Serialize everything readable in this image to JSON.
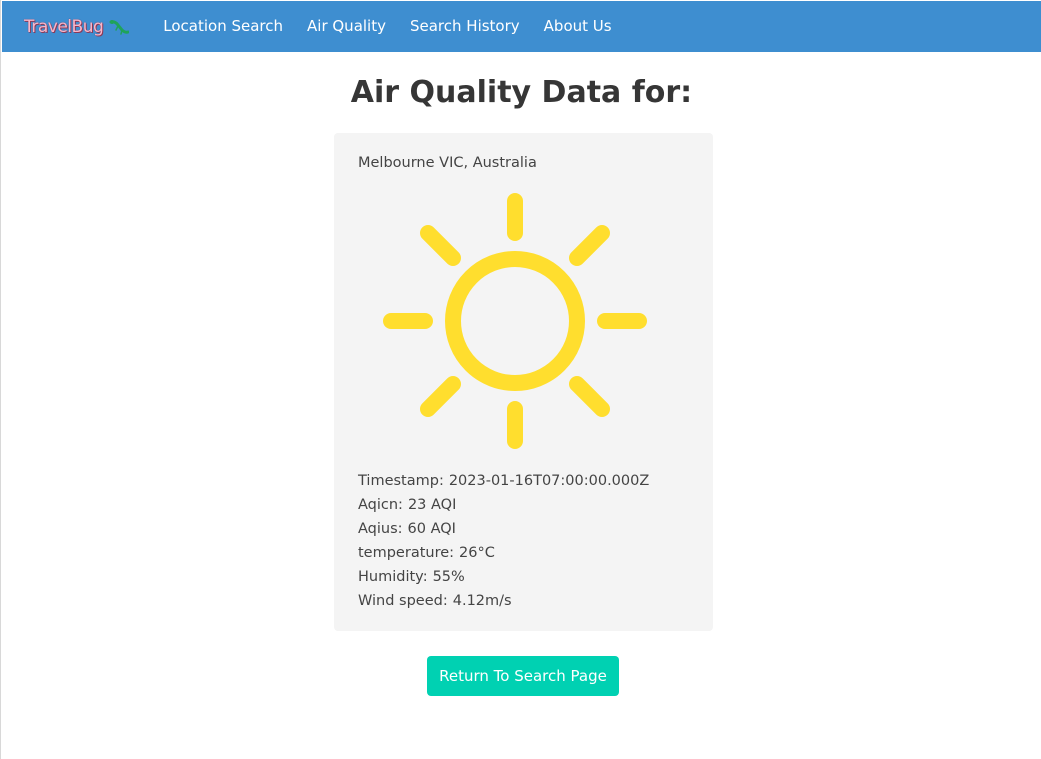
{
  "navbar": {
    "brand": "TravelBug",
    "brand_icon": "bug-icon",
    "links": [
      {
        "label": "Location Search"
      },
      {
        "label": "Air Quality"
      },
      {
        "label": "Search History"
      },
      {
        "label": "About Us"
      }
    ]
  },
  "main": {
    "title": "Air Quality Data for:"
  },
  "card": {
    "location": "Melbourne VIC, Australia",
    "weather_icon": "sun-icon",
    "stats": [
      {
        "label": "Timestamp:",
        "value": "2023-01-16T07:00:00.000Z"
      },
      {
        "label": "Aqicn:",
        "value": "23 AQI"
      },
      {
        "label": "Aqius:",
        "value": "60 AQI"
      },
      {
        "label": "temperature:",
        "value": "26°C"
      },
      {
        "label": "Humidity:",
        "value": "55%"
      },
      {
        "label": "Wind speed:",
        "value": "4.12m/s"
      }
    ]
  },
  "actions": {
    "return_label": "Return To Search Page"
  },
  "colors": {
    "navbar": "#3e8ed0",
    "card": "#f4f4f4",
    "sun": "#ffde2e",
    "button": "#00d1b2",
    "brand_text": "#f9b6c8"
  }
}
